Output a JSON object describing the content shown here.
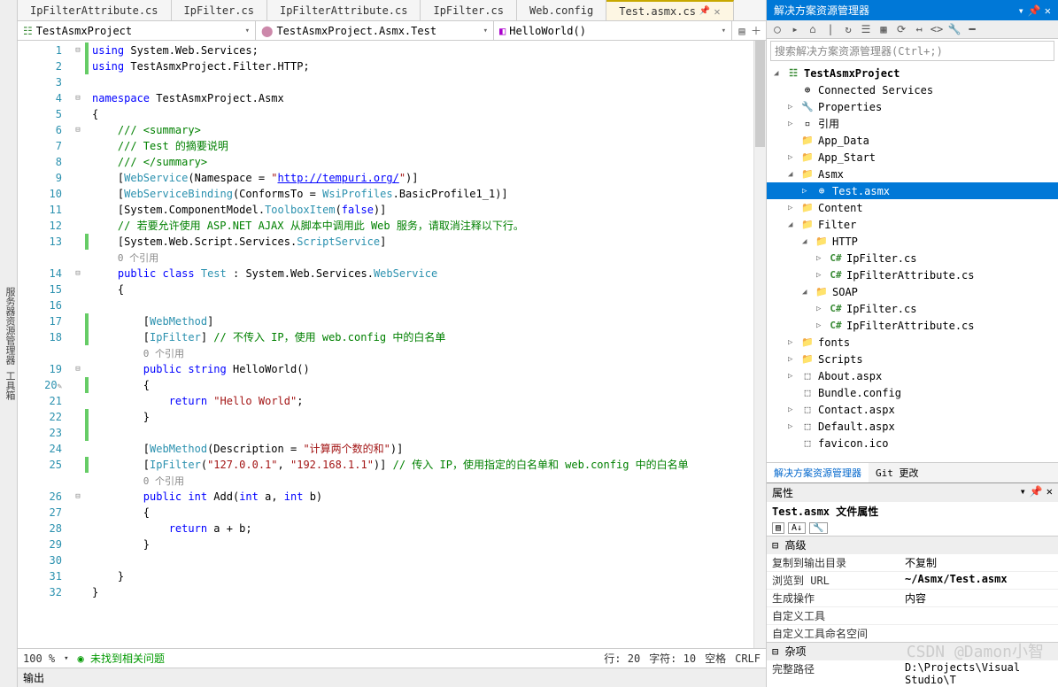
{
  "sidebars": {
    "left": "服务器资源管理器  工具箱"
  },
  "tabs": [
    {
      "label": "IpFilterAttribute.cs"
    },
    {
      "label": "IpFilter.cs"
    },
    {
      "label": "IpFilterAttribute.cs"
    },
    {
      "label": "IpFilter.cs"
    },
    {
      "label": "Web.config"
    },
    {
      "label": "Test.asmx.cs",
      "active": true,
      "pinned": true
    }
  ],
  "breadcrumbs": {
    "project": "TestAsmxProject",
    "class": "TestAsmxProject.Asmx.Test",
    "method": "HelloWorld()"
  },
  "code": {
    "lines": [
      {
        "n": 1,
        "ch": "g",
        "fold": "⊟",
        "html": "<span class='kw'>using</span> System.Web.Services;"
      },
      {
        "n": 2,
        "ch": "g",
        "html": "<span class='kw'>using</span> TestAsmxProject.Filter.HTTP;"
      },
      {
        "n": 3,
        "html": ""
      },
      {
        "n": 4,
        "fold": "⊟",
        "html": "<span class='kw'>namespace</span> TestAsmxProject.Asmx"
      },
      {
        "n": 5,
        "html": "{"
      },
      {
        "n": 6,
        "fold": "⊟",
        "html": "    <span class='cm'>/// &lt;summary&gt;</span>"
      },
      {
        "n": 7,
        "html": "    <span class='cm'>/// Test 的摘要说明</span>"
      },
      {
        "n": 8,
        "html": "    <span class='cm'>/// &lt;/summary&gt;</span>"
      },
      {
        "n": 9,
        "html": "    [<span class='cls'>WebService</span>(Namespace = <span class='str'>\"<span class='url'>http://tempuri.org/</span>\"</span>)]"
      },
      {
        "n": 10,
        "html": "    [<span class='cls'>WebServiceBinding</span>(ConformsTo = <span class='cls'>WsiProfiles</span>.BasicProfile1_1)]"
      },
      {
        "n": 11,
        "html": "    [System.ComponentModel.<span class='cls'>ToolboxItem</span>(<span class='kw'>false</span>)]"
      },
      {
        "n": 12,
        "html": "    <span class='cm'>// 若要允许使用 ASP.NET AJAX 从脚本中调用此 Web 服务，请取消注释以下行。</span>"
      },
      {
        "n": 13,
        "ch": "g",
        "html": "    [System.Web.Script.Services.<span class='cls'>ScriptService</span>]"
      },
      {
        "n": "",
        "html": "    <span class='tiny'>0 个引用</span>"
      },
      {
        "n": 14,
        "fold": "⊟",
        "html": "    <span class='kw'>public</span> <span class='kw'>class</span> <span class='cls'>Test</span> : System.Web.Services.<span class='cls'>WebService</span>"
      },
      {
        "n": 15,
        "html": "    {"
      },
      {
        "n": 16,
        "html": ""
      },
      {
        "n": 17,
        "ch": "g",
        "html": "        [<span class='cls'>WebMethod</span>]"
      },
      {
        "n": 18,
        "ch": "g",
        "html": "        [<span class='cls'>IpFilter</span>] <span class='cm'>// 不传入 IP，使用 web.config 中的白名单</span>"
      },
      {
        "n": "",
        "html": "        <span class='tiny'>0 个引用</span>"
      },
      {
        "n": 19,
        "fold": "⊟",
        "html": "        <span class='kw'>public</span> <span class='kw'>string</span> <span>HelloWorld</span>()"
      },
      {
        "n": 20,
        "ch": "g",
        "pencil": true,
        "html": "        {"
      },
      {
        "n": 21,
        "html": "            <span class='kw'>return</span> <span class='str'>\"Hello World\"</span>;"
      },
      {
        "n": 22,
        "ch": "g",
        "html": "        }"
      },
      {
        "n": 23,
        "ch": "g",
        "html": ""
      },
      {
        "n": 24,
        "html": "        [<span class='cls'>WebMethod</span>(Description = <span class='str'>\"计算两个数的和\"</span>)]"
      },
      {
        "n": 25,
        "ch": "g",
        "html": "        [<span class='cls'>IpFilter</span>(<span class='str'>\"127.0.0.1\"</span>, <span class='str'>\"192.168.1.1\"</span>)] <span class='cm'>// 传入 IP，使用指定的白名单和 web.config 中的白名单</span>"
      },
      {
        "n": "",
        "html": "        <span class='tiny'>0 个引用</span>"
      },
      {
        "n": 26,
        "fold": "⊟",
        "html": "        <span class='kw'>public</span> <span class='kw'>int</span> Add(<span class='kw'>int</span> a, <span class='kw'>int</span> b)"
      },
      {
        "n": 27,
        "html": "        {"
      },
      {
        "n": 28,
        "html": "            <span class='kw'>return</span> a + b;"
      },
      {
        "n": 29,
        "html": "        }"
      },
      {
        "n": 30,
        "html": ""
      },
      {
        "n": 31,
        "html": "    }"
      },
      {
        "n": 32,
        "html": "}"
      }
    ]
  },
  "status": {
    "zoom": "100 %",
    "issues": "未找到相关问题",
    "line": "行: 20",
    "col": "字符: 10",
    "spaces": "空格",
    "crlf": "CRLF"
  },
  "output_label": "输出",
  "solution_panel": {
    "title": "解决方案资源管理器",
    "search_placeholder": "搜索解决方案资源管理器(Ctrl+;)",
    "tree": [
      {
        "indent": 0,
        "exp": "◢",
        "icon": "☷",
        "iconCls": "icon-proj",
        "label": "TestAsmxProject",
        "bold": true
      },
      {
        "indent": 1,
        "icon": "⊕",
        "label": "Connected Services"
      },
      {
        "indent": 1,
        "exp": "▷",
        "icon": "🔧",
        "label": "Properties"
      },
      {
        "indent": 1,
        "exp": "▷",
        "icon": "▫",
        "label": "引用"
      },
      {
        "indent": 1,
        "icon": "📁",
        "iconCls": "icon-folder",
        "label": "App_Data"
      },
      {
        "indent": 1,
        "exp": "▷",
        "icon": "📁",
        "iconCls": "icon-folder",
        "label": "App_Start"
      },
      {
        "indent": 1,
        "exp": "◢",
        "icon": "📁",
        "iconCls": "icon-folder",
        "label": "Asmx"
      },
      {
        "indent": 2,
        "exp": "▷",
        "icon": "⊕",
        "label": "Test.asmx",
        "selected": true
      },
      {
        "indent": 1,
        "exp": "▷",
        "icon": "📁",
        "iconCls": "icon-folder",
        "label": "Content"
      },
      {
        "indent": 1,
        "exp": "◢",
        "icon": "📁",
        "iconCls": "icon-folder",
        "label": "Filter"
      },
      {
        "indent": 2,
        "exp": "◢",
        "icon": "📁",
        "iconCls": "icon-folder",
        "label": "HTTP"
      },
      {
        "indent": 3,
        "exp": "▷",
        "icon": "C#",
        "iconCls": "icon-cs",
        "label": "IpFilter.cs"
      },
      {
        "indent": 3,
        "exp": "▷",
        "icon": "C#",
        "iconCls": "icon-cs",
        "label": "IpFilterAttribute.cs"
      },
      {
        "indent": 2,
        "exp": "◢",
        "icon": "📁",
        "iconCls": "icon-folder",
        "label": "SOAP"
      },
      {
        "indent": 3,
        "exp": "▷",
        "icon": "C#",
        "iconCls": "icon-cs",
        "label": "IpFilter.cs"
      },
      {
        "indent": 3,
        "exp": "▷",
        "icon": "C#",
        "iconCls": "icon-cs",
        "label": "IpFilterAttribute.cs"
      },
      {
        "indent": 1,
        "exp": "▷",
        "icon": "📁",
        "iconCls": "icon-folder",
        "label": "fonts"
      },
      {
        "indent": 1,
        "exp": "▷",
        "icon": "📁",
        "iconCls": "icon-folder",
        "label": "Scripts"
      },
      {
        "indent": 1,
        "exp": "▷",
        "icon": "⬚",
        "label": "About.aspx"
      },
      {
        "indent": 1,
        "icon": "⬚",
        "label": "Bundle.config"
      },
      {
        "indent": 1,
        "exp": "▷",
        "icon": "⬚",
        "label": "Contact.aspx"
      },
      {
        "indent": 1,
        "exp": "▷",
        "icon": "⬚",
        "label": "Default.aspx"
      },
      {
        "indent": 1,
        "icon": "⬚",
        "label": "favicon.ico"
      }
    ],
    "tabs": [
      "解决方案资源管理器",
      "Git 更改"
    ]
  },
  "properties": {
    "title": "属性",
    "subtitle": "Test.asmx 文件属性",
    "groups": [
      {
        "name": "高级",
        "rows": [
          {
            "k": "复制到输出目录",
            "v": "不复制"
          },
          {
            "k": "浏览到 URL",
            "v": "~/Asmx/Test.asmx",
            "bold": true
          },
          {
            "k": "生成操作",
            "v": "内容"
          },
          {
            "k": "自定义工具",
            "v": ""
          },
          {
            "k": "自定义工具命名空间",
            "v": ""
          }
        ]
      },
      {
        "name": "杂项",
        "rows": [
          {
            "k": "完整路径",
            "v": "D:\\Projects\\Visual Studio\\T"
          }
        ]
      }
    ]
  },
  "watermark": "CSDN @Damon小智"
}
